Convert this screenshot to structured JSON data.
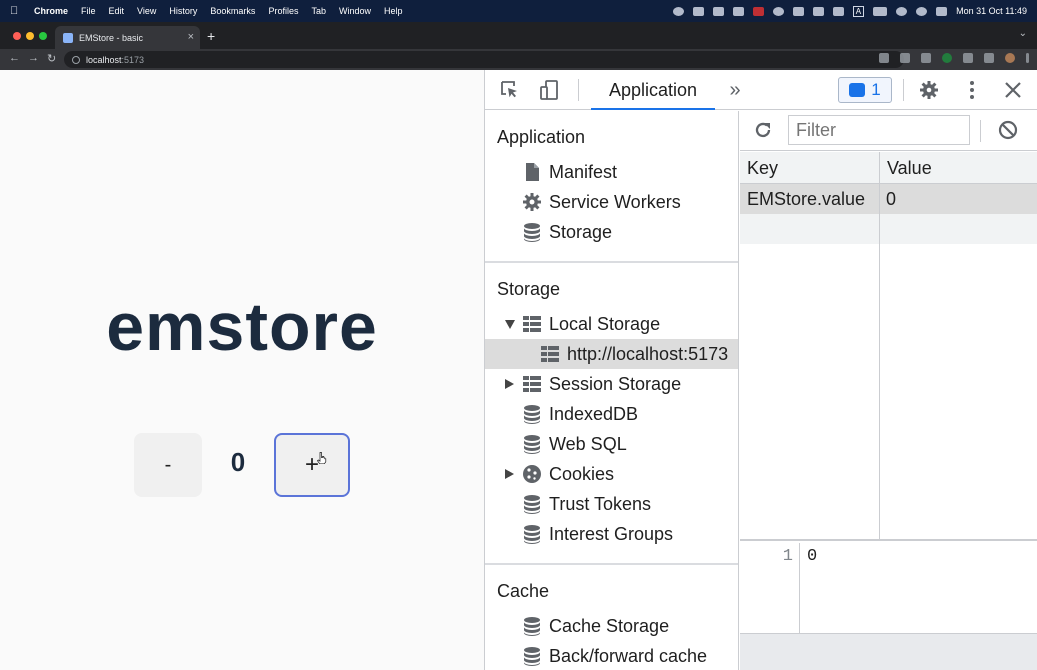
{
  "menubar": {
    "app_name": "Chrome",
    "menus": [
      "File",
      "Edit",
      "View",
      "History",
      "Bookmarks",
      "Profiles",
      "Tab",
      "Window",
      "Help"
    ],
    "clock": "Mon 31 Oct  11:49",
    "input_source": "A"
  },
  "browser": {
    "tab_title": "EMStore - basic",
    "url_host": "localhost",
    "url_port": ":5173"
  },
  "page": {
    "logo_text": "emstore",
    "minus_label": "-",
    "count_value": "0",
    "plus_label": "+"
  },
  "devtools": {
    "active_tab": "Application",
    "more_tabs": "»",
    "messages_count": "1",
    "sidebar": {
      "application_header": "Application",
      "application_items": [
        "Manifest",
        "Service Workers",
        "Storage"
      ],
      "storage_header": "Storage",
      "storage_items": [
        "Local Storage",
        "http://localhost:5173",
        "Session Storage",
        "IndexedDB",
        "Web SQL",
        "Cookies",
        "Trust Tokens",
        "Interest Groups"
      ],
      "cache_header": "Cache",
      "cache_items": [
        "Cache Storage",
        "Back/forward cache"
      ]
    },
    "storage_view": {
      "filter_placeholder": "Filter",
      "columns": [
        "Key",
        "Value"
      ],
      "rows": [
        {
          "key": "EMStore.value",
          "value": "0"
        }
      ],
      "preview_line_number": "1",
      "preview_value": "0"
    }
  },
  "colors": {
    "logo": "#1c2b3e",
    "accent": "#1a73e8",
    "plus_border": "#5b74d8"
  }
}
